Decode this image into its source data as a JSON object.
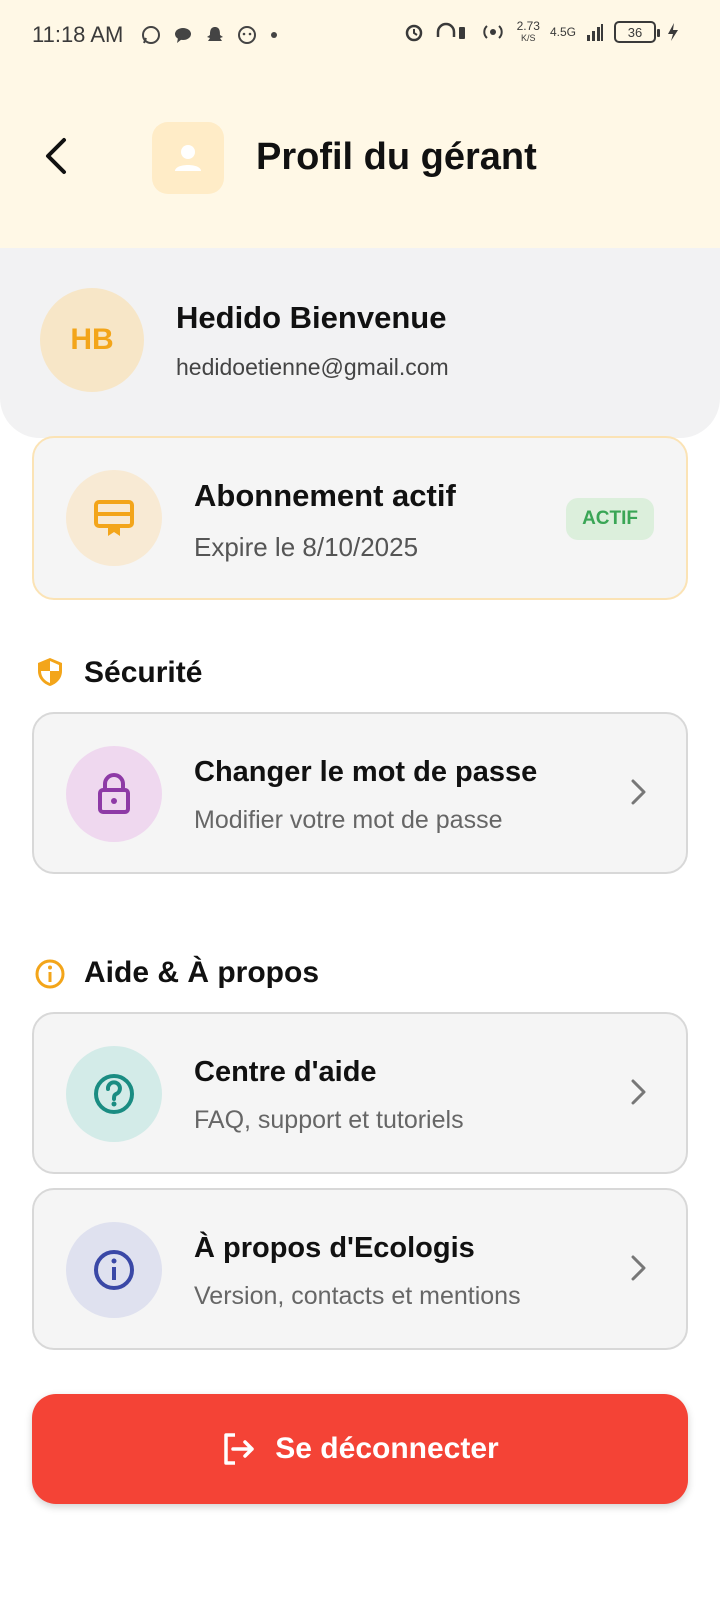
{
  "status": {
    "time": "11:18 AM",
    "speed_value": "2.73",
    "speed_unit": "K/S",
    "network": "4.5G",
    "battery": "36"
  },
  "header": {
    "title": "Profil du gérant"
  },
  "profile": {
    "initials": "HB",
    "name": "Hedido Bienvenue",
    "email": "hedidoetienne@gmail.com"
  },
  "subscription": {
    "title": "Abonnement actif",
    "expires": "Expire le 8/10/2025",
    "badge": "ACTIF"
  },
  "security": {
    "section_title": "Sécurité",
    "items": [
      {
        "title": "Changer le mot de passe",
        "subtitle": "Modifier votre mot de passe"
      }
    ]
  },
  "help": {
    "section_title": "Aide & À propos",
    "items": [
      {
        "title": "Centre d'aide",
        "subtitle": "FAQ, support et tutoriels"
      },
      {
        "title": "À propos d'Ecologis",
        "subtitle": "Version, contacts et mentions"
      }
    ]
  },
  "logout": {
    "label": "Se déconnecter"
  },
  "colors": {
    "accent": "#f3a51a",
    "header_bg": "#fff8e6",
    "logout_bg": "#f44336",
    "badge_text": "#3aa656",
    "lock_icon": "#8e3aa6",
    "help_icon": "#1a8c82",
    "info_icon": "#3a48a6"
  },
  "icons": {
    "back": "arrow-back-icon",
    "user": "person-icon",
    "subscription": "card-membership-icon",
    "security": "shield-icon",
    "lock": "lock-icon",
    "info_section": "info-icon",
    "help": "help-circle-icon",
    "about": "info-icon",
    "chevron": "chevron-right-icon",
    "logout": "logout-icon"
  }
}
